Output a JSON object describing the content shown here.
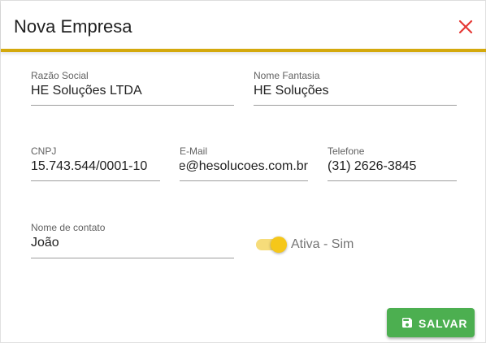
{
  "dialog": {
    "title": "Nova Empresa",
    "close_icon": "close-icon",
    "accent_color": "#d4a90c",
    "close_color": "#e53935"
  },
  "form": {
    "razao_social": {
      "label": "Razão Social",
      "value": "HE Soluções LTDA"
    },
    "nome_fantasia": {
      "label": "Nome Fantasia",
      "value": "HE Soluções"
    },
    "cnpj": {
      "label": "CNPJ",
      "value": "15.743.544/0001-10"
    },
    "email": {
      "label": "E-Mail",
      "value": "e@hesolucoes.com.br"
    },
    "telefone": {
      "label": "Telefone",
      "value": "(31) 2626-3845"
    },
    "nome_contato": {
      "label": "Nome de contato",
      "value": "João"
    },
    "ativa": {
      "label": "Ativa - Sim",
      "checked": true,
      "color": "#f5c71a"
    }
  },
  "actions": {
    "save_label": "SALVAR",
    "save_icon": "save-icon",
    "save_color": "#4caf50"
  }
}
